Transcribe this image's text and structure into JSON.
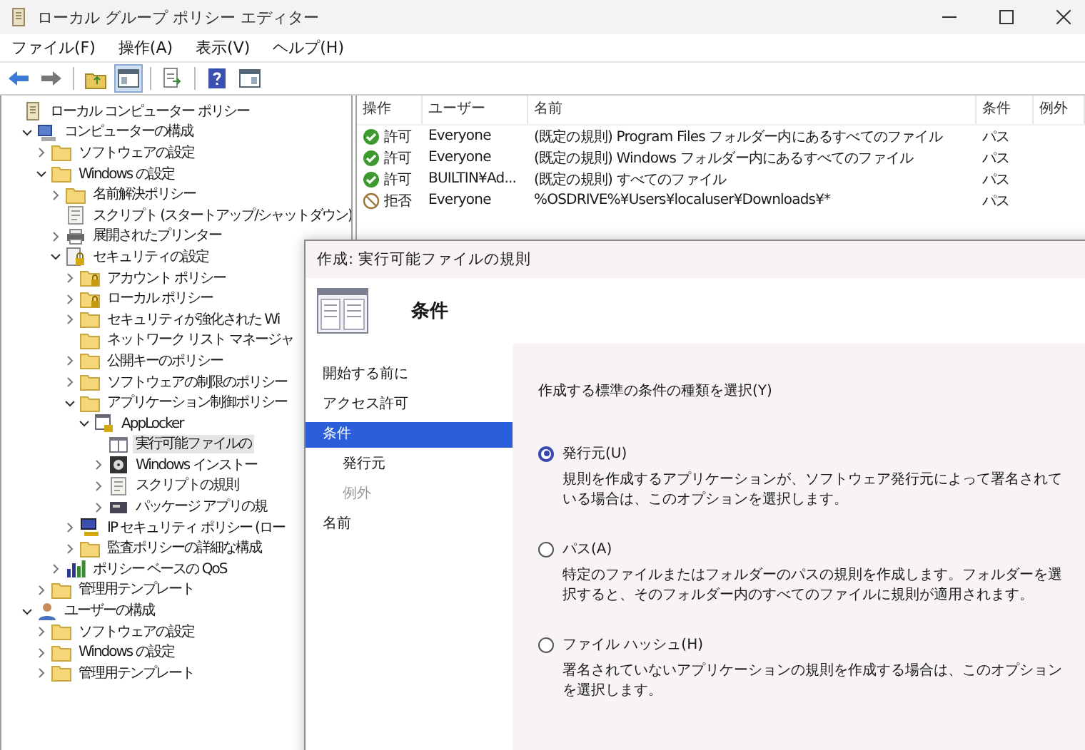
{
  "window": {
    "title": "ローカル グループ ポリシー エディター"
  },
  "menu": [
    "ファイル(F)",
    "操作(A)",
    "表示(V)",
    "ヘルプ(H)"
  ],
  "toolbar": [
    [
      {
        "kind": "back",
        "pressed": false
      },
      {
        "kind": "forward",
        "pressed": false
      }
    ],
    [
      {
        "kind": "up",
        "pressed": false
      },
      {
        "kind": "tree",
        "pressed": true
      }
    ],
    [
      {
        "kind": "export",
        "pressed": false
      }
    ],
    [
      {
        "kind": "help",
        "pressed": false
      },
      {
        "kind": "pane",
        "pressed": false
      }
    ]
  ],
  "tree": [
    {
      "label": "ローカル コンピューター ポリシー",
      "kind": "policy",
      "selected": false,
      "children": [
        {
          "label": "コンピューターの構成",
          "kind": "computer",
          "expanded": true,
          "selected": false,
          "children": [
            {
              "label": "ソフトウェアの設定",
              "kind": "folder",
              "expanded": false,
              "selected": false
            },
            {
              "label": "Windows の設定",
              "kind": "folder",
              "expanded": true,
              "selected": false,
              "children": [
                {
                  "label": "名前解決ポリシー",
                  "kind": "folder",
                  "expanded": false,
                  "selected": false
                },
                {
                  "label": "スクリプト (スタートアップ/シャットダウン)",
                  "kind": "script",
                  "selected": false
                },
                {
                  "label": "展開されたプリンター",
                  "kind": "printer",
                  "expanded": false,
                  "selected": false
                },
                {
                  "label": "セキュリティの設定",
                  "kind": "security",
                  "expanded": true,
                  "selected": false,
                  "children": [
                    {
                      "label": "アカウント ポリシー",
                      "kind": "lockfolder",
                      "expanded": false,
                      "selected": false
                    },
                    {
                      "label": "ローカル ポリシー",
                      "kind": "lockfolder",
                      "expanded": false,
                      "selected": false
                    },
                    {
                      "label": "セキュリティが強化された Wi",
                      "kind": "folder",
                      "expanded": false,
                      "selected": false
                    },
                    {
                      "label": "ネットワーク リスト マネージャ",
                      "kind": "folder",
                      "selected": false
                    },
                    {
                      "label": "公開キーのポリシー",
                      "kind": "folder",
                      "expanded": false,
                      "selected": false
                    },
                    {
                      "label": "ソフトウェアの制限のポリシー",
                      "kind": "folder",
                      "expanded": false,
                      "selected": false
                    },
                    {
                      "label": "アプリケーション制御ポリシー",
                      "kind": "folder",
                      "expanded": true,
                      "selected": false,
                      "children": [
                        {
                          "label": "AppLocker",
                          "kind": "applocker",
                          "expanded": true,
                          "selected": false,
                          "children": [
                            {
                              "label": "実行可能ファイルの",
                              "kind": "rules",
                              "selected": true
                            },
                            {
                              "label": "Windows インストー",
                              "kind": "installer",
                              "expanded": false,
                              "selected": false
                            },
                            {
                              "label": "スクリプトの規則",
                              "kind": "script",
                              "expanded": false,
                              "selected": false
                            },
                            {
                              "label": "パッケージ アプリの規",
                              "kind": "package",
                              "expanded": false,
                              "selected": false
                            }
                          ]
                        }
                      ]
                    },
                    {
                      "label": "IP セキュリティ ポリシー (ロー",
                      "kind": "ip",
                      "expanded": false,
                      "selected": false
                    },
                    {
                      "label": "監査ポリシーの詳細な構成",
                      "kind": "folder",
                      "expanded": false,
                      "selected": false
                    }
                  ]
                },
                {
                  "label": "ポリシー ベースの QoS",
                  "kind": "qos",
                  "expanded": false,
                  "selected": false
                }
              ]
            },
            {
              "label": "管理用テンプレート",
              "kind": "folder",
              "expanded": false,
              "selected": false
            }
          ]
        },
        {
          "label": "ユーザーの構成",
          "kind": "user",
          "expanded": true,
          "selected": false,
          "children": [
            {
              "label": "ソフトウェアの設定",
              "kind": "folder",
              "expanded": false,
              "selected": false
            },
            {
              "label": "Windows の設定",
              "kind": "folder",
              "expanded": false,
              "selected": false
            },
            {
              "label": "管理用テンプレート",
              "kind": "folder",
              "expanded": false,
              "selected": false
            }
          ]
        }
      ]
    }
  ],
  "rule_list": {
    "columns": [
      "操作",
      "ユーザー",
      "名前",
      "条件",
      "例外"
    ],
    "rows": [
      {
        "kind": "allow",
        "action": "許可",
        "user": "Everyone",
        "name": "(既定の規則) Program Files フォルダー内にあるすべてのファイル",
        "condition": "パス"
      },
      {
        "kind": "allow",
        "action": "許可",
        "user": "Everyone",
        "name": "(既定の規則) Windows フォルダー内にあるすべてのファイル",
        "condition": "パス"
      },
      {
        "kind": "allow",
        "action": "許可",
        "user": "BUILTIN¥Ad...",
        "name": "(既定の規則) すべてのファイル",
        "condition": "パス"
      },
      {
        "kind": "deny",
        "action": "拒否",
        "user": "Everyone",
        "name": "%OSDRIVE%¥Users¥localuser¥Downloads¥*",
        "condition": "パス"
      }
    ]
  },
  "dialog": {
    "title": "作成: 実行可能ファイルの規則",
    "heading": "条件",
    "steps": [
      {
        "label": "開始する前に",
        "selected": false,
        "disabled": false
      },
      {
        "label": "アクセス許可",
        "selected": false,
        "disabled": false
      },
      {
        "label": "条件",
        "selected": true,
        "disabled": false,
        "children": [
          {
            "label": "発行元",
            "selected": false,
            "disabled": false
          },
          {
            "label": "例外",
            "selected": false,
            "disabled": true
          }
        ]
      },
      {
        "label": "名前",
        "selected": false,
        "disabled": false
      }
    ],
    "prompt": "作成する標準の条件の種類を選択(Y)",
    "options": [
      {
        "label": "発行元(U)",
        "selected": true,
        "description": "規則を作成するアプリケーションが、ソフトウェア発行元によって署名されている場合は、このオプションを選択します。"
      },
      {
        "label": "パス(A)",
        "selected": false,
        "description": "特定のファイルまたはフォルダーのパスの規則を作成します。フォルダーを選択すると、そのフォルダー内のすべてのファイルに規則が適用されます。"
      },
      {
        "label": "ファイル ハッシュ(H)",
        "selected": false,
        "description": "署名されていないアプリケーションの規則を作成する場合は、このオプションを選択します。"
      }
    ]
  }
}
